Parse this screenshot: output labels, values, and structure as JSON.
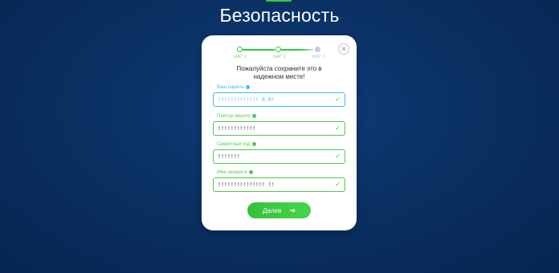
{
  "page": {
    "title": "Безопасность"
  },
  "colors": {
    "accent_green": "#35c73a",
    "info_blue": "#3fb9e8",
    "background": "#0a3164"
  },
  "stepper": {
    "steps": [
      {
        "label": "ШАГ 1",
        "state": "done"
      },
      {
        "label": "ШАГ 2",
        "state": "current"
      },
      {
        "label": "ШАГ 3",
        "state": "pending"
      }
    ]
  },
  "card": {
    "notice_line1": "Пожалуйста сохраните это в",
    "notice_line2": "надежном месте!",
    "close_icon": "close-icon"
  },
  "fields": [
    {
      "label": "Ваш пароль",
      "value": "!!!!!!!!!!!!! 0.0!",
      "icon": "info-icon"
    },
    {
      "label": "Повтор пароля",
      "value": "!!!!!!!!!!!!",
      "icon": "info-icon"
    },
    {
      "label": "Секретный код",
      "value": "!!!!!!!",
      "icon": "info-icon"
    },
    {
      "label": "Имя аккаунта",
      "value": "!!!!!!!!!!!!!!! !!",
      "icon": "info-icon"
    }
  ],
  "actions": {
    "next_label": "Далее",
    "next_icon": "arrow-right-icon"
  }
}
